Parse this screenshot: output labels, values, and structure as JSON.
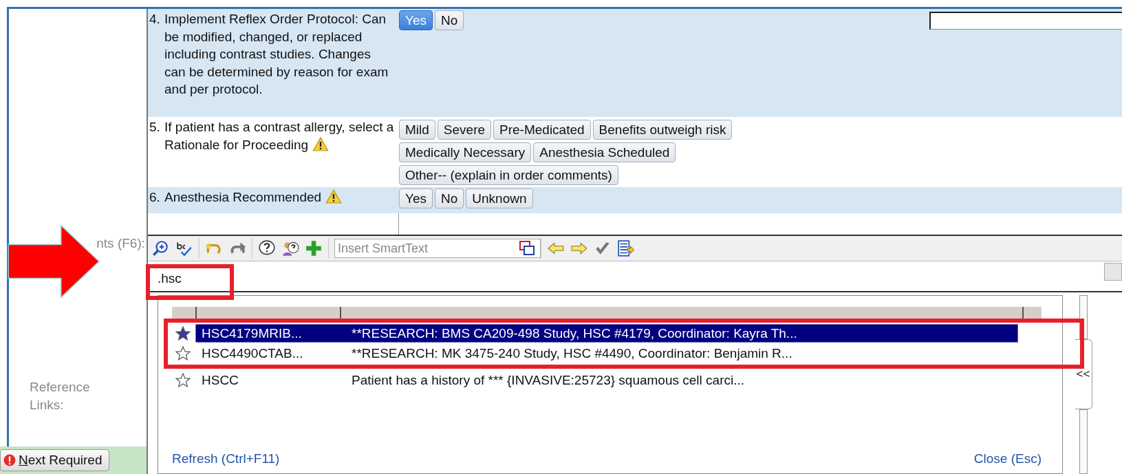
{
  "questions": [
    {
      "number": "4.",
      "text": "Implement Reflex Order Protocol: Can be modified, changed, or replaced including contrast studies. Changes can be determined by reason for exam and per protocol.",
      "warning": false,
      "comment_field": true,
      "options": [
        {
          "label": "Yes",
          "selected": true
        },
        {
          "label": "No",
          "selected": false
        }
      ]
    },
    {
      "number": "5.",
      "text": "If patient has a contrast allergy, select a Rationale for Proceeding",
      "warning": true,
      "comment_field": false,
      "options": [
        {
          "label": "Mild",
          "selected": false
        },
        {
          "label": "Severe",
          "selected": false
        },
        {
          "label": "Pre-Medicated",
          "selected": false
        },
        {
          "label": "Benefits outweigh risk",
          "selected": false
        },
        {
          "label": "Medically Necessary",
          "selected": false
        },
        {
          "label": "Anesthesia Scheduled",
          "selected": false
        },
        {
          "label": "Other-- (explain in order comments)",
          "selected": false
        }
      ]
    },
    {
      "number": "6.",
      "text": "Anesthesia Recommended",
      "warning": true,
      "comment_field": false,
      "options": [
        {
          "label": "Yes",
          "selected": false
        },
        {
          "label": "No",
          "selected": false
        },
        {
          "label": "Unknown",
          "selected": false
        }
      ]
    }
  ],
  "comments_label": "nts (F6):",
  "reference_label": "Reference Links:",
  "next_button": "Next Required",
  "smarttext": {
    "placeholder": "Insert SmartText"
  },
  "comment_value": ".hsc",
  "popup": {
    "rows": [
      {
        "abbrev": "HSC4179MRIB...",
        "expansion": "**RESEARCH: BMS CA209-498 Study, HSC #4179, Coordinator: Kayra Th...",
        "selected": true
      },
      {
        "abbrev": "HSC4490CTAB...",
        "expansion": "**RESEARCH: MK 3475-240 Study, HSC #4490, Coordinator: Benjamin R...",
        "selected": false
      },
      {
        "abbrev": "HSCC",
        "expansion": "Patient has a history of *** {INVASIVE:25723} squamous cell carci...",
        "selected": false
      }
    ],
    "refresh_link": "Refresh (Ctrl+F11)",
    "close_link": "Close (Esc)"
  },
  "side_tab": "<<"
}
